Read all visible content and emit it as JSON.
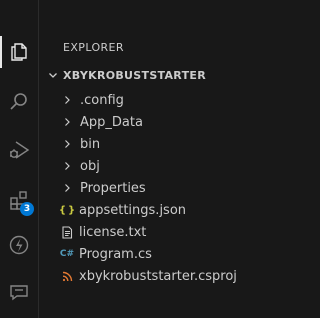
{
  "explorer": {
    "title": "EXPLORER",
    "root_folder": "XBYKROBUSTSTARTER",
    "folders": [
      ".config",
      "App_Data",
      "bin",
      "obj",
      "Properties"
    ],
    "files": [
      {
        "name": "appsettings.json",
        "icon": "json-icon",
        "glyph": "{ }",
        "color": "#cbcb41"
      },
      {
        "name": "license.txt",
        "icon": "text-file-icon",
        "glyph": "",
        "color": "#cccccc"
      },
      {
        "name": "Program.cs",
        "icon": "csharp-icon",
        "glyph": "C#",
        "color": "#519aba"
      },
      {
        "name": "xbykrobuststarter.csproj",
        "icon": "rss-icon",
        "glyph": "",
        "color": "#e37933"
      }
    ]
  },
  "activity_bar": {
    "extensions_badge": "3"
  },
  "colors": {
    "background": "#181818",
    "text": "#cccccc",
    "badge": "#0078d4"
  }
}
